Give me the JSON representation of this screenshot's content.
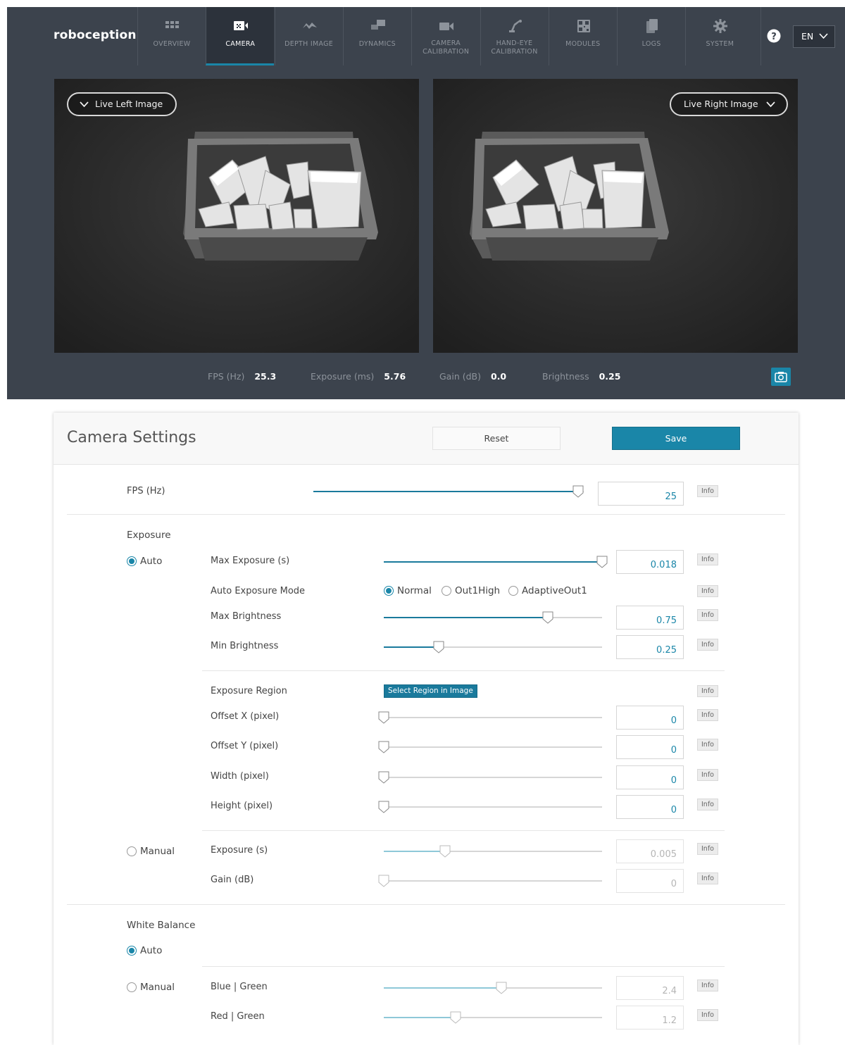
{
  "brand": "roboception",
  "nav": {
    "items": [
      {
        "label": "OVERVIEW",
        "icon": "grid-icon"
      },
      {
        "label": "CAMERA",
        "icon": "camera-icon"
      },
      {
        "label": "DEPTH IMAGE",
        "icon": "depth-image-icon"
      },
      {
        "label": "DYNAMICS",
        "icon": "dynamics-icon"
      },
      {
        "label": "CAMERA\nCALIBRATION",
        "icon": "video-camera-icon"
      },
      {
        "label": "HAND-EYE\nCALIBRATION",
        "icon": "robot-arm-icon"
      },
      {
        "label": "MODULES",
        "icon": "qr-code-icon"
      },
      {
        "label": "LOGS",
        "icon": "document-icon"
      },
      {
        "label": "SYSTEM",
        "icon": "gear-icon"
      }
    ],
    "active": "CAMERA",
    "language": "EN"
  },
  "camera_view": {
    "left_select": "Live Left Image",
    "right_select": "Live Right Image",
    "stats": {
      "fps_label": "FPS (Hz)",
      "fps_value": "25.3",
      "exposure_label": "Exposure (ms)",
      "exposure_value": "5.76",
      "gain_label": "Gain (dB)",
      "gain_value": "0.0",
      "brightness_label": "Brightness",
      "brightness_value": "0.25"
    }
  },
  "settings": {
    "title": "Camera Settings",
    "reset_label": "Reset",
    "save_label": "Save",
    "info_label": "Info",
    "fps": {
      "label": "FPS (Hz)",
      "value": "25",
      "level": 0.98
    },
    "exposure": {
      "section_label": "Exposure",
      "auto_label": "Auto",
      "manual_label": "Manual",
      "mode_selected": "Auto",
      "max_exposure": {
        "label": "Max Exposure (s)",
        "value": "0.018",
        "level": 1.0
      },
      "auto_exposure_mode": {
        "label": "Auto Exposure Mode",
        "options": [
          "Normal",
          "Out1High",
          "AdaptiveOut1"
        ],
        "selected": "Normal"
      },
      "max_brightness": {
        "label": "Max Brightness",
        "value": "0.75",
        "level": 0.75
      },
      "min_brightness": {
        "label": "Min Brightness",
        "value": "0.25",
        "level": 0.25
      },
      "region": {
        "label": "Exposure Region",
        "button_label": "Select Region in Image"
      },
      "offset_x": {
        "label": "Offset X (pixel)",
        "value": "0",
        "level": 0
      },
      "offset_y": {
        "label": "Offset Y (pixel)",
        "value": "0",
        "level": 0
      },
      "width": {
        "label": "Width (pixel)",
        "value": "0",
        "level": 0
      },
      "height": {
        "label": "Height (pixel)",
        "value": "0",
        "level": 0
      },
      "manual_exposure": {
        "label": "Exposure (s)",
        "value": "0.005",
        "level": 0.28
      },
      "manual_gain": {
        "label": "Gain (dB)",
        "value": "0",
        "level": 0
      }
    },
    "white_balance": {
      "section_label": "White Balance",
      "auto_label": "Auto",
      "manual_label": "Manual",
      "mode_selected": "Auto",
      "blue_green": {
        "label": "Blue | Green",
        "value": "2.4",
        "level": 0.54
      },
      "red_green": {
        "label": "Red | Green",
        "value": "1.2",
        "level": 0.33
      }
    }
  },
  "colors": {
    "accent": "#1a86a8",
    "navbar": "#3c434d",
    "nav_active": "#2c323b"
  }
}
